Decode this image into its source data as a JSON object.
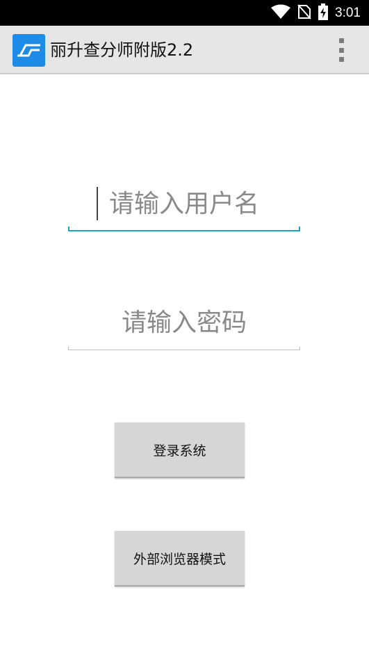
{
  "status_bar": {
    "time": "3:01",
    "icons": [
      "wifi-icon",
      "no-sim-icon",
      "battery-charging-icon"
    ]
  },
  "app_bar": {
    "title": "丽升查分师附版2.2",
    "logo_icon": "app-logo-icon",
    "menu_icon": "overflow-menu-icon"
  },
  "form": {
    "username_placeholder": "请输入用户名",
    "password_placeholder": "请输入密码",
    "login_button": "登录系统",
    "browser_button": "外部浏览器模式"
  },
  "colors": {
    "accent": "#1aa4c4",
    "logo": "#1e8be6",
    "appbar": "#e6e6e6",
    "button": "#d6d6d6"
  }
}
